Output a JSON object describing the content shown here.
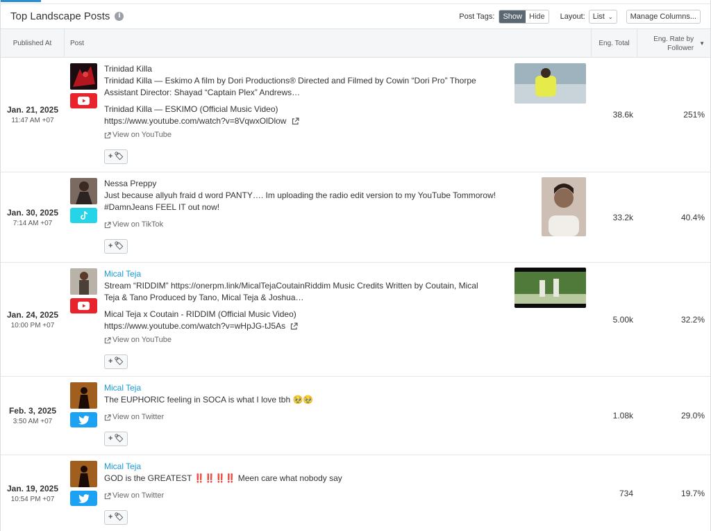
{
  "header": {
    "title": "Top Landscape Posts",
    "post_tags_label": "Post Tags:",
    "show_label": "Show",
    "hide_label": "Hide",
    "layout_label": "Layout:",
    "layout_value": "List",
    "manage_label": "Manage Columns..."
  },
  "columns": {
    "published": "Published At",
    "post": "Post",
    "eng_total": "Eng. Total",
    "eng_rate_line1": "Eng. Rate by",
    "eng_rate_line2": "Follower"
  },
  "colors": {
    "accent": "#2a8fd0",
    "youtube": "#e8232b",
    "tiktok": "#26d4e8",
    "twitter": "#1da1f2",
    "link": "#1a9ad6"
  },
  "rows": [
    {
      "date": "Jan. 21, 2025",
      "time": "11:47 AM +07",
      "platform": "youtube",
      "platform_icon": "youtube-icon",
      "author": "Trinidad Killa",
      "caption_line1": "Trinidad Killa — Eskimo A film by Dori Productions® Directed and Filmed by Cowin “Dori Pro” Thorpe",
      "caption_line2": "Assistant Director: Shayad “Captain Plex” Andrews…",
      "video_title": "Trinidad Killa — ESKIMO (Official Music Video)",
      "url": "https://www.youtube.com/watch?v=8VqwxOlDlow",
      "view_label": "View on YouTube",
      "eng_total": "38.6k",
      "eng_rate": "251%"
    },
    {
      "date": "Jan. 30, 2025",
      "time": "7:14 AM +07",
      "platform": "tiktok",
      "platform_icon": "tiktok-icon",
      "author": "Nessa Preppy",
      "caption_line1": "Just because allyuh fraid d word PANTY…. Im uploading the radio edit version to my YouTube Tommorow!",
      "caption_line2": "#DamnJeans FEEL IT out now!",
      "view_label": "View on TikTok",
      "eng_total": "33.2k",
      "eng_rate": "40.4%"
    },
    {
      "date": "Jan. 24, 2025",
      "time": "10:00 PM +07",
      "platform": "youtube",
      "platform_icon": "youtube-icon",
      "author": "Mical Teja",
      "caption_line1": "Stream “RIDDIM” https://onerpm.link/MicalTejaCoutainRiddim Music Credits Written by Coutain, Mical",
      "caption_line2": "Teja & Tano Produced by Tano, Mical Teja & Joshua…",
      "video_title": "Mical Teja x Coutain - RIDDIM (Official Music Video)",
      "url": "https://www.youtube.com/watch?v=wHpJG-tJ5As",
      "view_label": "View on YouTube",
      "eng_total": "5.00k",
      "eng_rate": "32.2%"
    },
    {
      "date": "Feb. 3, 2025",
      "time": "3:50 AM +07",
      "platform": "twitter",
      "platform_icon": "twitter-icon",
      "author": "Mical Teja",
      "caption_line1": "The EUPHORIC feeling in SOCA is what I love tbh 🥹🥹",
      "view_label": "View on Twitter",
      "eng_total": "1.08k",
      "eng_rate": "29.0%"
    },
    {
      "date": "Jan. 19, 2025",
      "time": "10:54 PM +07",
      "platform": "twitter",
      "platform_icon": "twitter-icon",
      "author": "Mical Teja",
      "caption_line1_prefix": "GOD is the GREATEST",
      "caption_line1_emphasis": "‼️‼️‼️‼️",
      "caption_line1_suffix": "Meen care what nobody say",
      "view_label": "View on Twitter",
      "eng_total": "734",
      "eng_rate": "19.7%"
    }
  ]
}
